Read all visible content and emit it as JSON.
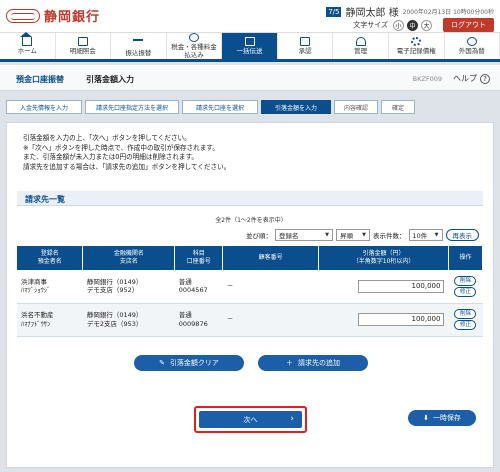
{
  "header": {
    "bank_name": "静岡銀行",
    "uid_badge": "7/5",
    "user_name": "静岡太郎 様",
    "last_login": "2000年02月13日 10時00分00秒",
    "font_size_label": "文字サイズ",
    "font_sizes": [
      "小",
      "中",
      "大"
    ],
    "font_size_selected": "中",
    "logout": "ログアウト"
  },
  "nav": [
    {
      "label": "ホーム",
      "icon": "home-icon"
    },
    {
      "label": "明細照会",
      "icon": "document-icon"
    },
    {
      "label": "振込振替",
      "icon": "transfer-icon"
    },
    {
      "label": "税金・各種料金\n払込み",
      "icon": "yen-icon"
    },
    {
      "label": "一括伝送",
      "icon": "batch-icon",
      "active": true
    },
    {
      "label": "承認",
      "icon": "approve-icon"
    },
    {
      "label": "管理",
      "icon": "manage-icon"
    },
    {
      "label": "電子記録債権",
      "icon": "gear-icon"
    },
    {
      "label": "外国為替",
      "icon": "globe-icon"
    }
  ],
  "page": {
    "crumb": "預金口座振替",
    "title": "引落金額入力",
    "screen_id": "BKZF009",
    "help": "ヘルプ"
  },
  "steps": [
    {
      "label": "入金先情報を入力",
      "state": "done"
    },
    {
      "label": "請求先口座指定方法を選択",
      "state": "done"
    },
    {
      "label": "請求先口座を選択",
      "state": "done"
    },
    {
      "label": "引落金額を入力",
      "state": "current"
    },
    {
      "label": "内容確認",
      "state": "todo"
    },
    {
      "label": "確定",
      "state": "todo"
    }
  ],
  "instructions": [
    "引落金額を入力の上、「次へ」ボタンを押してください。",
    "※「次へ」ボタンを押した時点で、作成中の取引が保存されます。",
    "また、引落金額が未入力または0円の明細は削除されます。",
    "請求先を追加する場合は、「請求先の追加」ボタンを押してください。"
  ],
  "list": {
    "title": "請求先一覧",
    "count": "全2件（1～2件を表示中）",
    "sort_label": "並び順：",
    "sort_field": "登録名",
    "sort_order": "昇順",
    "per_page_label": "表示件数：",
    "per_page": "10件",
    "redisplay": "再表示",
    "columns": [
      "登録名\n預金者名",
      "金融機関名\n支店名",
      "科目\n口座番号",
      "顧客番号",
      "引落金額（円）\n（半角数字10桁以内）",
      "操作"
    ],
    "rows": [
      {
        "name": "浜津商事",
        "kana": "ﾊﾏﾂﾞｼｮｳｼﾞ",
        "bank": "静岡銀行（0149）",
        "branch": "デモ支店（952）",
        "type": "普通",
        "account": "0004567",
        "customer": "－",
        "amount": "100,000"
      },
      {
        "name": "浜名不動産",
        "kana": "ﾊﾏﾅﾌﾄﾞｳｻﾝ",
        "bank": "静岡銀行（0149）",
        "branch": "デモ2支店（953）",
        "type": "普通",
        "account": "0009876",
        "customer": "－",
        "amount": "100,000"
      }
    ],
    "op_delete": "削除",
    "op_edit": "修正"
  },
  "buttons": {
    "clear": "引落金額クリア",
    "add": "請求先の追加",
    "next": "次へ",
    "save": "一時保存"
  },
  "colors": {
    "brand_red": "#c0392b",
    "primary_blue": "#0b4e8e",
    "button_blue": "#1c5fa8",
    "highlight_red": "#e02020"
  }
}
